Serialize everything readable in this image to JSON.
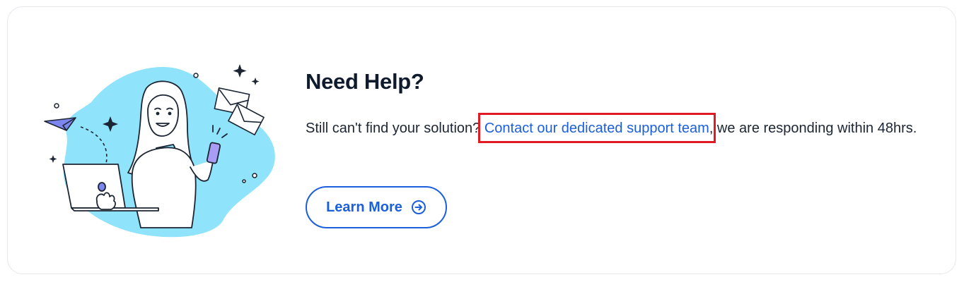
{
  "help": {
    "title": "Need Help?",
    "text_before": "Still can't find your solution? ",
    "link_text": "Contact our dedicated support team",
    "text_after": ", we are responding within 48hrs.",
    "button_label": "Learn More",
    "button_icon": "arrow-right-circle-icon"
  },
  "colors": {
    "accent": "#1b5fdc",
    "illustration_blob": "#8fe3fb",
    "highlight": "#e01b24",
    "title": "#0f1b2d"
  }
}
